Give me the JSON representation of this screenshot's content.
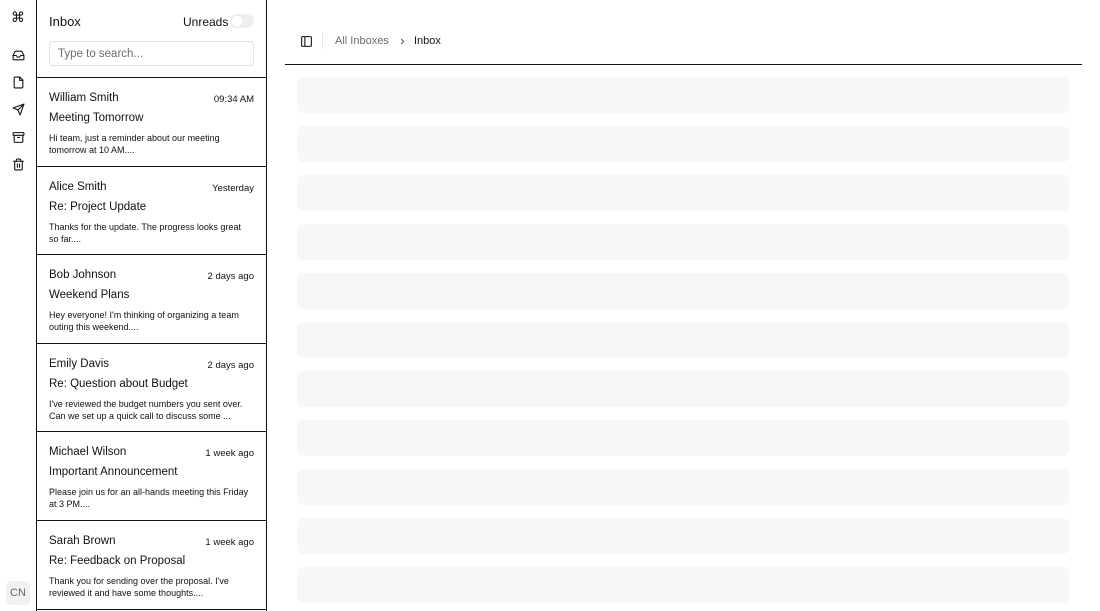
{
  "rail": {
    "logo_icon": "command-icon",
    "nav": [
      "inbox-icon",
      "file-icon",
      "send-icon",
      "archive-icon",
      "trash-icon"
    ],
    "avatar_initials": "CN"
  },
  "mail_list": {
    "title": "Inbox",
    "unreads_label": "Unreads",
    "unreads_enabled": false,
    "search_placeholder": "Type to search...",
    "items": [
      {
        "from": "William Smith",
        "time": "09:34 AM",
        "subject": "Meeting Tomorrow",
        "preview": "Hi team, just a reminder about our meeting tomorrow at 10 AM...."
      },
      {
        "from": "Alice Smith",
        "time": "Yesterday",
        "subject": "Re: Project Update",
        "preview": "Thanks for the update. The progress looks great so far...."
      },
      {
        "from": "Bob Johnson",
        "time": "2 days ago",
        "subject": "Weekend Plans",
        "preview": "Hey everyone! I'm thinking of organizing a team outing this weekend...."
      },
      {
        "from": "Emily Davis",
        "time": "2 days ago",
        "subject": "Re: Question about Budget",
        "preview": "I've reviewed the budget numbers you sent over. Can we set up a quick call to discuss some ..."
      },
      {
        "from": "Michael Wilson",
        "time": "1 week ago",
        "subject": "Important Announcement",
        "preview": "Please join us for an all-hands meeting this Friday at 3 PM...."
      },
      {
        "from": "Sarah Brown",
        "time": "1 week ago",
        "subject": "Re: Feedback on Proposal",
        "preview": "Thank you for sending over the proposal. I've reviewed it and have some thoughts...."
      }
    ]
  },
  "main": {
    "breadcrumb": {
      "root": "All Inboxes",
      "current": "Inbox"
    }
  },
  "colors": {
    "border": "#111111",
    "skeleton": "#f7f7f7",
    "muted_text": "#6b6b6b"
  }
}
